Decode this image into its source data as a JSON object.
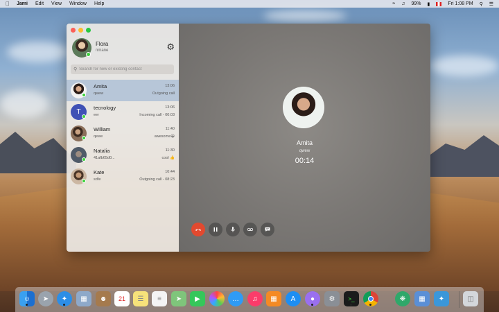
{
  "menubar": {
    "app_name": "Jami",
    "menus": [
      "Edit",
      "View",
      "Window",
      "Help"
    ],
    "battery": "99%",
    "clock": "Fri 1:08 PM"
  },
  "profile": {
    "name": "Flora",
    "handle": "nmane"
  },
  "search": {
    "placeholder": "Search for new or existing contact"
  },
  "conversations": [
    {
      "name": "Amita",
      "sub": "qwew",
      "time": "13:06",
      "last": "Outgoing call",
      "initial": ""
    },
    {
      "name": "tecnology",
      "sub": "eer",
      "time": "13:06",
      "last": "Incoming call - 00:03",
      "initial": "T"
    },
    {
      "name": "William",
      "sub": "qewe",
      "time": "11:40",
      "last": "awesome😀",
      "initial": ""
    },
    {
      "name": "Natalia",
      "sub": "41afb65d0...",
      "time": "11:30",
      "last": "cool 👍",
      "initial": ""
    },
    {
      "name": "Kate",
      "sub": "sdfe",
      "time": "10:44",
      "last": "Outgoing call - 08:23",
      "initial": ""
    }
  ],
  "call": {
    "name": "Amita",
    "sub": "qwew",
    "timer": "00:14"
  },
  "icons": {
    "gear": "gear-icon",
    "hangup": "phone-hangup-icon",
    "pause": "pause-icon",
    "mic": "microphone-icon",
    "record": "record-icon",
    "chat": "chat-icon"
  },
  "colors": {
    "selected_row": "#b7c6d8",
    "hangup": "#e2492f",
    "online": "#3cd13c",
    "avatar_tecnology": "#3f51b5"
  }
}
